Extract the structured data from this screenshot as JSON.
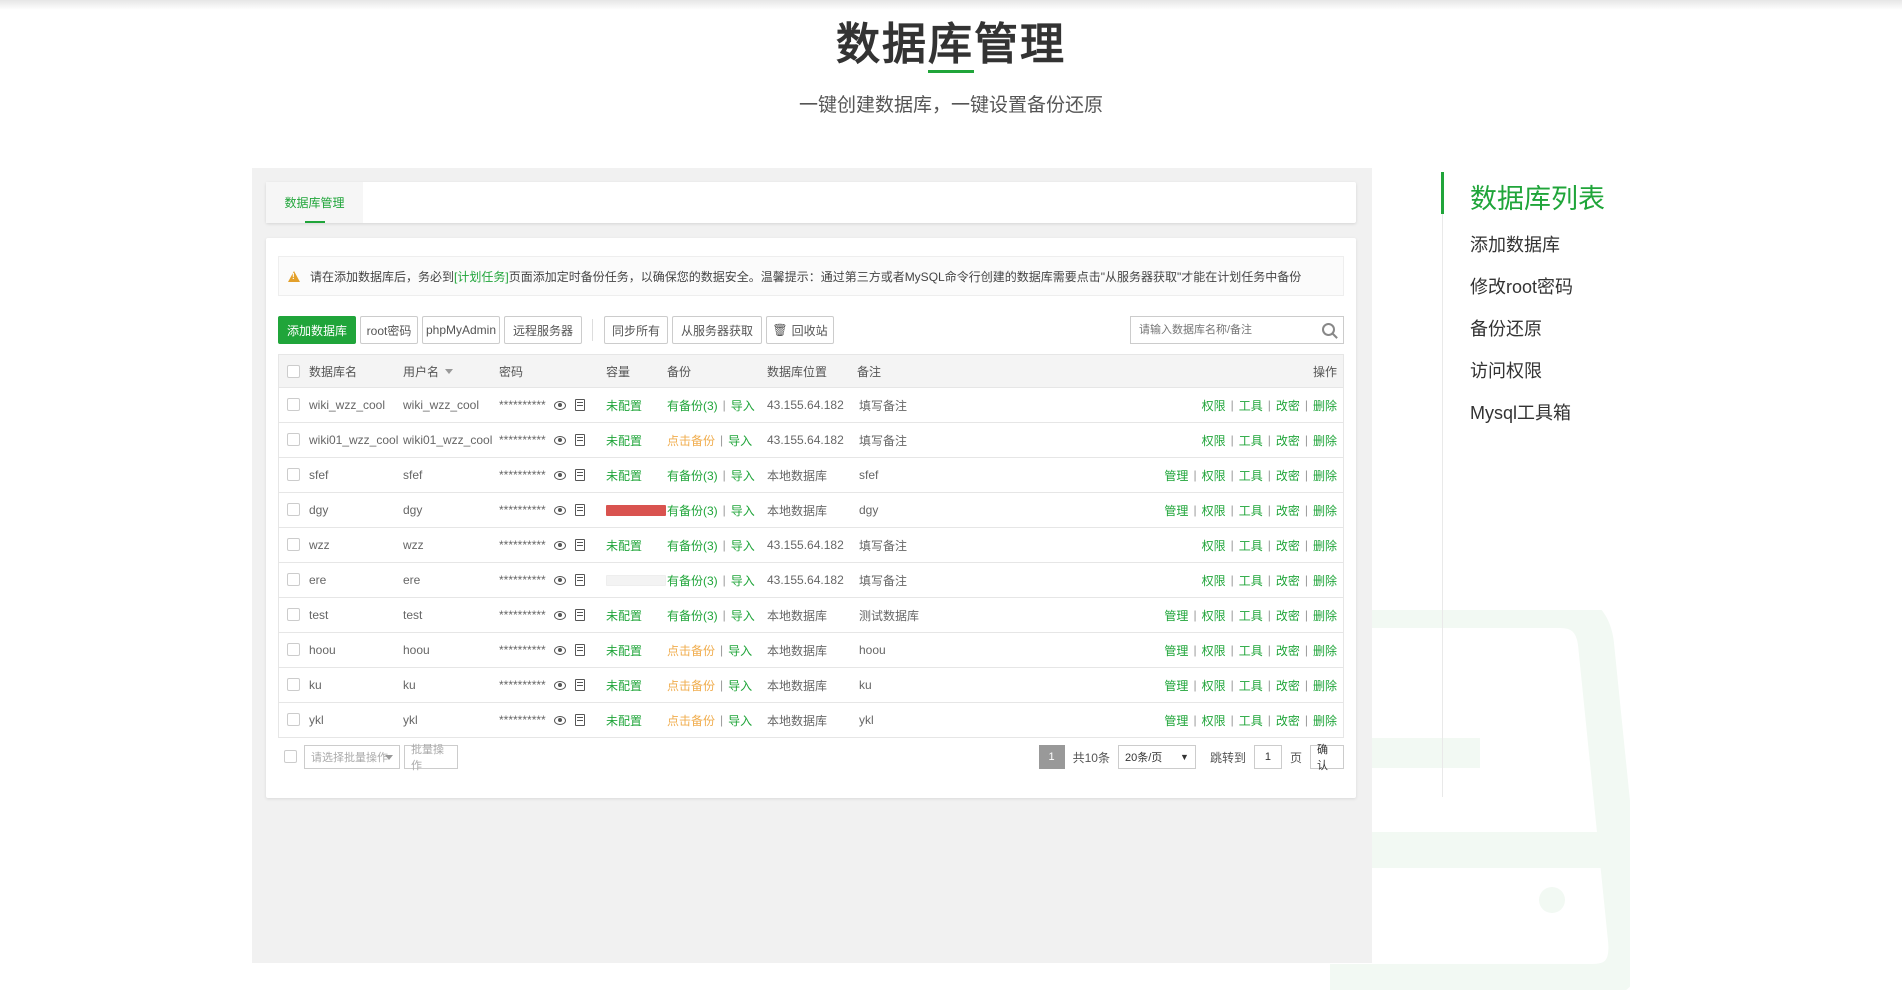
{
  "header": {
    "title": "数据库管理",
    "subtitle": "一键创建数据库，一键设置备份还原"
  },
  "panel": {
    "tab_active": "数据库管理",
    "notice": {
      "before": "请在添加数据库后，务必到",
      "link": "[计划任务]",
      "after": "页面添加定时备份任务，以确保您的数据安全。温馨提示：通过第三方或者MySQL命令行创建的数据库需要点击\"从服务器获取\"才能在计划任务中备份"
    },
    "toolbar": {
      "add_db": "添加数据库",
      "root_pwd": "root密码",
      "phpmyadmin": "phpMyAdmin",
      "remote_server": "远程服务器",
      "sync_all": "同步所有",
      "fetch_from_server": "从服务器获取",
      "recycle_bin": "回收站",
      "search_placeholder": "请输入数据库名称/备注"
    },
    "columns": {
      "name": "数据库名",
      "user": "用户名",
      "password": "密码",
      "capacity": "容量",
      "backup": "备份",
      "location": "数据库位置",
      "remark": "备注",
      "ops": "操作"
    },
    "rows": [
      {
        "name": "wiki_wzz_cool",
        "user": "wiki_wzz_cool",
        "password": "**********",
        "capacity": "未配置",
        "backup": "有备份(3)",
        "import": "导入",
        "location": "43.155.64.182",
        "remark": "填写备注",
        "manage": "",
        "perm": "权限",
        "tools": "工具",
        "change_pwd": "改密",
        "delete": "删除"
      },
      {
        "name": "wiki01_wzz_cool",
        "user": "wiki01_wzz_cool",
        "password": "**********",
        "capacity": "未配置",
        "backup": "点击备份",
        "import": "导入",
        "location": "43.155.64.182",
        "remark": "填写备注",
        "manage": "",
        "perm": "权限",
        "tools": "工具",
        "change_pwd": "改密",
        "delete": "删除"
      },
      {
        "name": "sfef",
        "user": "sfef",
        "password": "**********",
        "capacity": "未配置",
        "backup": "有备份(3)",
        "import": "导入",
        "location": "本地数据库",
        "remark": "sfef",
        "manage": "管理",
        "perm": "权限",
        "tools": "工具",
        "change_pwd": "改密",
        "delete": "删除"
      },
      {
        "name": "dgy",
        "user": "dgy",
        "password": "**********",
        "capacity": "",
        "backup": "有备份(3)",
        "import": "导入",
        "location": "本地数据库",
        "remark": "dgy",
        "manage": "管理",
        "perm": "权限",
        "tools": "工具",
        "change_pwd": "改密",
        "delete": "删除"
      },
      {
        "name": "wzz",
        "user": "wzz",
        "password": "**********",
        "capacity": "未配置",
        "backup": "有备份(3)",
        "import": "导入",
        "location": "43.155.64.182",
        "remark": "填写备注",
        "manage": "",
        "perm": "权限",
        "tools": "工具",
        "change_pwd": "改密",
        "delete": "删除"
      },
      {
        "name": "ere",
        "user": "ere",
        "password": "**********",
        "capacity": "",
        "backup": "有备份(3)",
        "import": "导入",
        "location": "43.155.64.182",
        "remark": "填写备注",
        "manage": "",
        "perm": "权限",
        "tools": "工具",
        "change_pwd": "改密",
        "delete": "删除"
      },
      {
        "name": "test",
        "user": "test",
        "password": "**********",
        "capacity": "未配置",
        "backup": "有备份(3)",
        "import": "导入",
        "location": "本地数据库",
        "remark": "测试数据库",
        "manage": "管理",
        "perm": "权限",
        "tools": "工具",
        "change_pwd": "改密",
        "delete": "删除"
      },
      {
        "name": "hoou",
        "user": "hoou",
        "password": "**********",
        "capacity": "未配置",
        "backup": "点击备份",
        "import": "导入",
        "location": "本地数据库",
        "remark": "hoou",
        "manage": "管理",
        "perm": "权限",
        "tools": "工具",
        "change_pwd": "改密",
        "delete": "删除"
      },
      {
        "name": "ku",
        "user": "ku",
        "password": "**********",
        "capacity": "未配置",
        "backup": "点击备份",
        "import": "导入",
        "location": "本地数据库",
        "remark": "ku",
        "manage": "管理",
        "perm": "权限",
        "tools": "工具",
        "change_pwd": "改密",
        "delete": "删除"
      },
      {
        "name": "ykl",
        "user": "ykl",
        "password": "**********",
        "capacity": "未配置",
        "backup": "点击备份",
        "import": "导入",
        "location": "本地数据库",
        "remark": "ykl",
        "manage": "管理",
        "perm": "权限",
        "tools": "工具",
        "change_pwd": "改密",
        "delete": "删除"
      }
    ],
    "footer": {
      "batch_select": "请选择批量操作",
      "batch_button": "批量操作",
      "current_page": "1",
      "total": "共10条",
      "per_page": "20条/页",
      "goto_label": "跳转到",
      "goto_value": "1",
      "page_unit": "页",
      "confirm": "确认"
    }
  },
  "sidebar": {
    "items": [
      "数据库列表",
      "添加数据库",
      "修改root密码",
      "备份还原",
      "访问权限",
      "Mysql工具箱"
    ]
  },
  "colors": {
    "accent": "#20a53a",
    "warning": "#f0ad4e",
    "danger": "#d9534f"
  }
}
